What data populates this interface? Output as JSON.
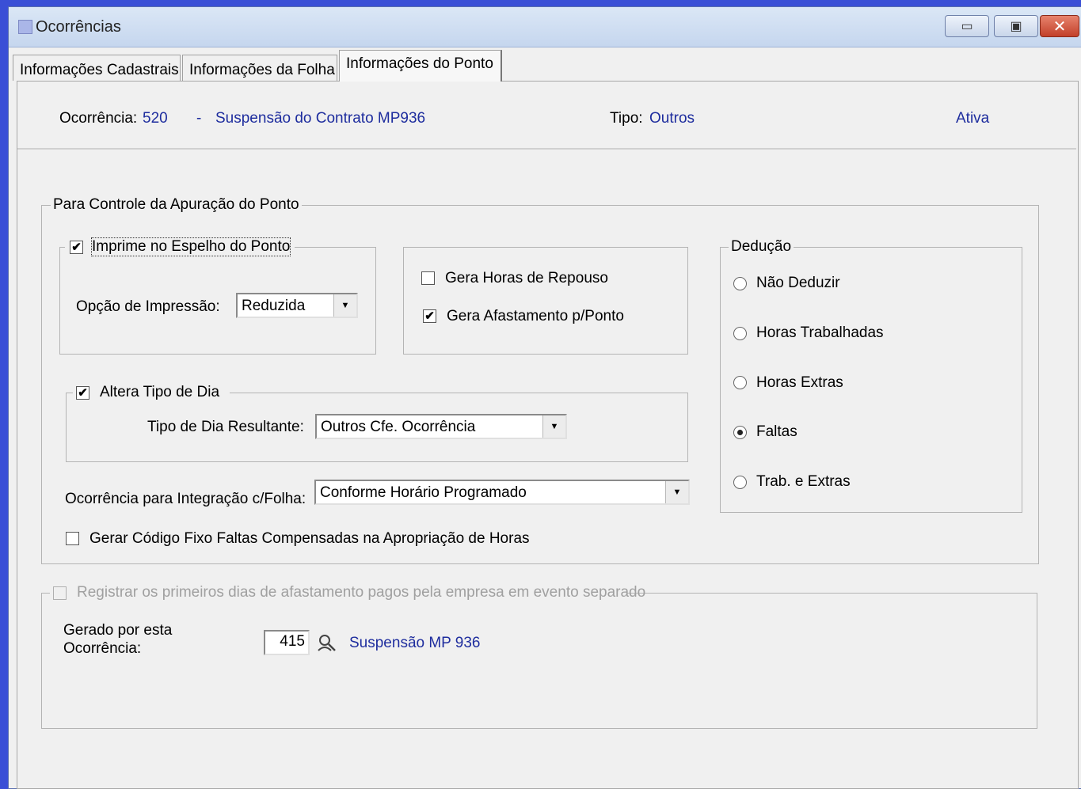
{
  "window": {
    "title": "Ocorrências"
  },
  "tabs": [
    {
      "label": "Informações Cadastrais"
    },
    {
      "label": "Informações da Folha"
    },
    {
      "label": "Informações do Ponto"
    }
  ],
  "header": {
    "ocorrencia_label": "Ocorrência:",
    "ocorrencia_code": "520",
    "separator": "-",
    "ocorrencia_desc": "Suspensão do Contrato MP936",
    "tipo_label": "Tipo:",
    "tipo_value": "Outros",
    "status": "Ativa"
  },
  "controle": {
    "legend": "Para Controle da Apuração do Ponto",
    "imprime_espelho": {
      "label": "Imprime no Espelho do Ponto",
      "checked": "✔"
    },
    "opcao_impressao": {
      "label": "Opção de Impressão:",
      "value": "Reduzida"
    },
    "gera_horas_repouso": {
      "label": "Gera Horas de Repouso",
      "checked": ""
    },
    "gera_afastamento": {
      "label": "Gera Afastamento p/Ponto",
      "checked": "✔"
    },
    "altera_tipo_dia": {
      "label": "Altera Tipo de Dia",
      "checked": "✔"
    },
    "tipo_dia_resultante": {
      "label": "Tipo de Dia Resultante:",
      "value": "Outros Cfe. Ocorrência"
    },
    "integracao_folha": {
      "label": "Ocorrência para Integração c/Folha:",
      "value": "Conforme Horário Programado"
    },
    "gerar_codigo_fixo": {
      "label": "Gerar Código Fixo Faltas Compensadas na Apropriação de Horas",
      "checked": ""
    }
  },
  "deducao": {
    "legend": "Dedução",
    "options": [
      {
        "label": "Não Deduzir",
        "selected": false
      },
      {
        "label": "Horas Trabalhadas",
        "selected": false
      },
      {
        "label": "Horas Extras",
        "selected": false
      },
      {
        "label": "Faltas",
        "selected": true
      },
      {
        "label": "Trab. e Extras",
        "selected": false
      }
    ]
  },
  "afastamento": {
    "legend": "Registrar os primeiros dias de afastamento pagos pela empresa em evento separado",
    "gerado_label_1": "Gerado por esta",
    "gerado_label_2": "Ocorrência:",
    "gerado_code": "415",
    "gerado_desc": "Suspensão MP 936"
  },
  "icons": {
    "lookup": "search-person-icon",
    "arrow": "▼"
  },
  "colors": {
    "link_blue": "#1e2d9e",
    "background": "#f0f0f0"
  }
}
